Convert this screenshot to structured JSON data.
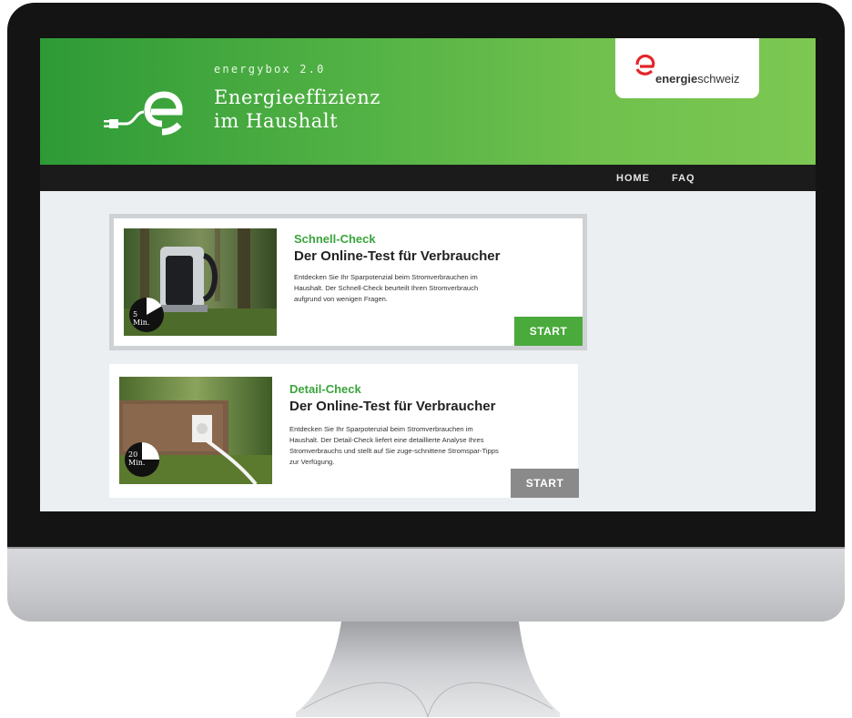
{
  "brand": {
    "small": "energybox 2.0",
    "title_line1": "Energieeffizienz",
    "title_line2": "im Haushalt"
  },
  "partner": {
    "bold": "energie",
    "light": "schweiz"
  },
  "nav": {
    "home": "HOME",
    "faq": "FAQ"
  },
  "cards": [
    {
      "eyebrow": "Schnell-Check",
      "headline": "Der Online-Test für Verbraucher",
      "description": "Entdecken Sie Ihr Sparpotenzial beim Stromverbrauchen im Haushalt. Der Schnell-Check beurteilt Ihren Stromverbrauch aufgrund von wenigen Fragen.",
      "timer_value": "5",
      "timer_unit": "Min.",
      "start": "START",
      "start_color": "#4aaa3c"
    },
    {
      "eyebrow": "Detail-Check",
      "headline": "Der Online-Test für Verbraucher",
      "description": "Entdecken Sie Ihr Sparpotenzial beim Stromverbrauchen im Haushalt. Der Detail-Check liefert eine detaillierte Analyse Ihres Stromverbrauchs und stellt auf Sie zuge-schnittene Stromspar-Tipps zur Verfügung.",
      "timer_value": "20",
      "timer_unit": "Min.",
      "start": "START",
      "start_color": "#8a8a8a"
    }
  ],
  "colors": {
    "header_green": "#56b446",
    "accent_green": "#3aa43c",
    "navbar": "#1b1b1b",
    "start_active": "#4aaa3c",
    "start_inactive": "#8a8a8a"
  }
}
